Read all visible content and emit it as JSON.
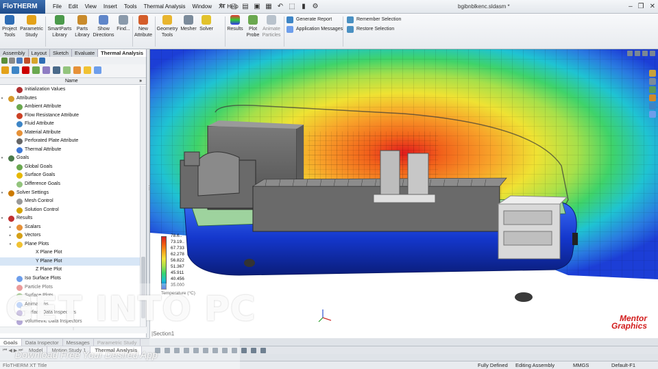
{
  "app": {
    "brand": "FloTHERM XT",
    "document": "bgibnblkenc.sldasm *",
    "menus": [
      "File",
      "Edit",
      "View",
      "Insert",
      "Tools",
      "Thermal Analysis",
      "Window",
      "XT Help"
    ]
  },
  "ribbon": {
    "buttons": [
      {
        "label": "Project\nTools",
        "icon": "project-tools-icon"
      },
      {
        "label": "Parametric\nStudy",
        "icon": "parametric-study-icon"
      },
      {
        "label": "SmartParts\nLibrary",
        "icon": "smartparts-icon"
      },
      {
        "label": "Parts\nLibrary",
        "icon": "parts-library-icon"
      },
      {
        "label": "Show\nDirections",
        "icon": "show-directions-icon"
      },
      {
        "label": "Find...",
        "icon": "find-icon"
      },
      {
        "label": "New\nAttribute",
        "icon": "new-attribute-icon"
      },
      {
        "label": "Geometry\nTools",
        "icon": "geometry-tools-icon"
      },
      {
        "label": "Mesher",
        "icon": "mesher-icon"
      },
      {
        "label": "Solver",
        "icon": "solver-icon"
      },
      {
        "label": "Results",
        "icon": "results-icon"
      },
      {
        "label": "Plot\nProbe",
        "icon": "plot-probe-icon"
      },
      {
        "label": "Animate\nParticles",
        "icon": "animate-particles-icon"
      }
    ],
    "report": {
      "generate": "Generate Report",
      "messages": "Application Messages"
    },
    "selection": {
      "remember": "Remember Selection",
      "restore": "Restore Selection"
    }
  },
  "cm_tabs": [
    "Assembly",
    "Layout",
    "Sketch",
    "Evaluate",
    "Thermal Analysis"
  ],
  "tree": {
    "column": "Name",
    "collapse": "»",
    "nodes": [
      {
        "label": "Initialization Values",
        "level": 1,
        "arrow": "",
        "color": "#b03030"
      },
      {
        "label": "Attributes",
        "level": 0,
        "arrow": "▾",
        "color": "#d49a2a"
      },
      {
        "label": "Ambient Attribute",
        "level": 1,
        "arrow": "",
        "color": "#6aa84f"
      },
      {
        "label": "Flow Resistance Attribute",
        "level": 1,
        "arrow": "",
        "color": "#cc4125"
      },
      {
        "label": "Fluid Attribute",
        "level": 1,
        "arrow": "",
        "color": "#3d85c6"
      },
      {
        "label": "Material Attribute",
        "level": 1,
        "arrow": "",
        "color": "#e69138"
      },
      {
        "label": "Perforated Plate Attribute",
        "level": 1,
        "arrow": "",
        "color": "#666666"
      },
      {
        "label": "Thermal Attribute",
        "level": 1,
        "arrow": "",
        "color": "#3c78d8"
      },
      {
        "label": "Goals",
        "level": 0,
        "arrow": "▾",
        "color": "#4a7a4a"
      },
      {
        "label": "Global Goals",
        "level": 1,
        "arrow": "",
        "color": "#6aa84f"
      },
      {
        "label": "Surface Goals",
        "level": 1,
        "arrow": "",
        "color": "#e6b800"
      },
      {
        "label": "Difference Goals",
        "level": 1,
        "arrow": "",
        "color": "#93c47d"
      },
      {
        "label": "Solver Settings",
        "level": 0,
        "arrow": "▾",
        "color": "#cc7a00"
      },
      {
        "label": "Mesh Control",
        "level": 1,
        "arrow": "",
        "color": "#999999"
      },
      {
        "label": "Solution Control",
        "level": 1,
        "arrow": "",
        "color": "#d6a400"
      },
      {
        "label": "Results",
        "level": 0,
        "arrow": "▾",
        "color": "#c03030"
      },
      {
        "label": "Scalars",
        "level": 1,
        "arrow": "▸",
        "color": "#e69138"
      },
      {
        "label": "Vectors",
        "level": 1,
        "arrow": "▸",
        "color": "#d4a017"
      },
      {
        "label": "Plane Plots",
        "level": 1,
        "arrow": "▾",
        "color": "#f1c232"
      },
      {
        "label": "X Plane Plot",
        "level": 2,
        "arrow": "",
        "color": ""
      },
      {
        "label": "Y Plane Plot",
        "level": 2,
        "arrow": "",
        "color": "",
        "selected": true
      },
      {
        "label": "Z Plane Plot",
        "level": 2,
        "arrow": "",
        "color": ""
      },
      {
        "label": "Iso Surface Plots",
        "level": 1,
        "arrow": "",
        "color": "#6d9eeb"
      },
      {
        "label": "Particle Plots",
        "level": 1,
        "arrow": "",
        "color": "#e06666"
      },
      {
        "label": "Surface Plots",
        "level": 1,
        "arrow": "",
        "color": "#93c47d"
      },
      {
        "label": "Animations",
        "level": 1,
        "arrow": "",
        "color": "#a4c2f4"
      },
      {
        "label": "Surface Data Inspectors",
        "level": 1,
        "arrow": "",
        "color": "#b4a7d6"
      },
      {
        "label": "Volumetric Data Inspectors",
        "level": 1,
        "arrow": "",
        "color": "#8e7cc3"
      }
    ]
  },
  "legend": {
    "values": [
      "78.6..",
      "73.19..",
      "67.733",
      "62.278",
      "56.822",
      "51.367",
      "45.911",
      "40.456",
      "35.000"
    ],
    "title": "Temperature (°C)"
  },
  "viewport": {
    "section": "|Section1",
    "logo": [
      "Mentor",
      "Graphics"
    ]
  },
  "bottom_tabs": [
    "Goals",
    "Data Inspector",
    "Messages",
    "Parametric Study"
  ],
  "model_tabs": [
    "Model",
    "Motion Study 1",
    "Thermal Analysis"
  ],
  "status": {
    "left": "FloTHERM XT Title",
    "defined": "Fully Defined",
    "editing": "Editing Assembly",
    "units": "MMGS",
    "config": "Default-F1"
  },
  "watermark": {
    "title": "GET INTO PC",
    "subtitle": "Download Free Your Desired App"
  }
}
